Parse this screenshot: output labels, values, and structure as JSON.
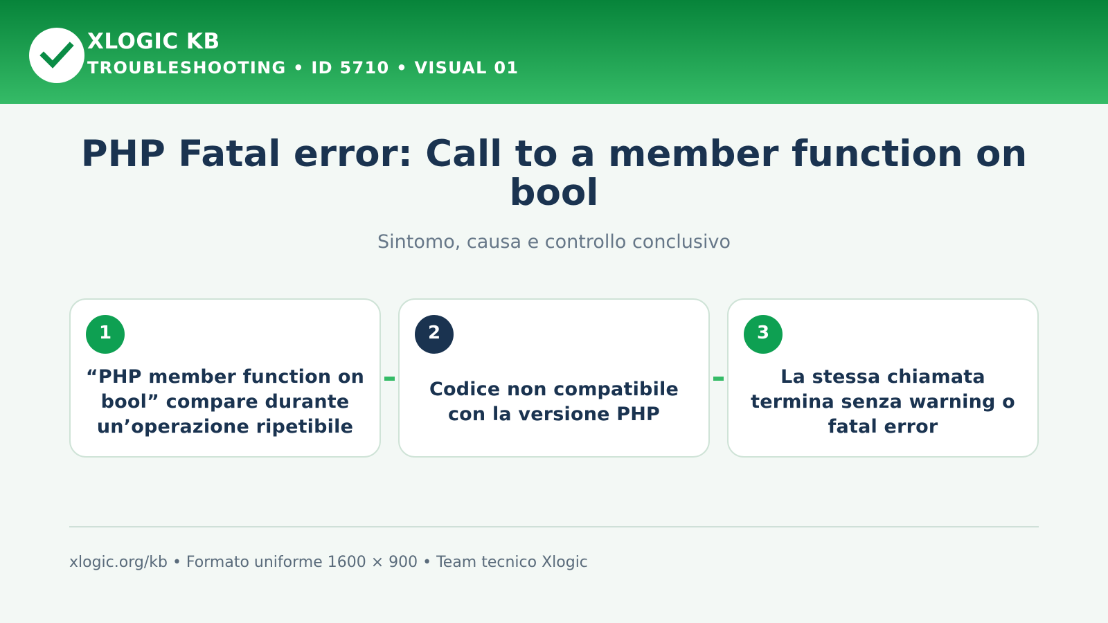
{
  "colors": {
    "header_gradient_top": "#07843a",
    "header_gradient_bottom": "#35bb67",
    "navy": "#1a3350",
    "green": "#0ea052",
    "page_background": "#f3f8f5"
  },
  "header": {
    "logo_icon": "checkmark-icon",
    "brand_title": "XLOGIC KB",
    "brand_subtitle": "TROUBLESHOOTING • ID 5710 • VISUAL 01"
  },
  "main": {
    "title": "PHP Fatal error: Call to a member function on bool",
    "subtitle": "Sintomo, causa e controllo conclusivo"
  },
  "steps": [
    {
      "number": "1",
      "badge_color": "#0ea052",
      "text": "“PHP member function on bool” compare durante un’operazione ripetibile"
    },
    {
      "number": "2",
      "badge_color": "#1a3350",
      "text": "Codice non compatibile con la versione PHP"
    },
    {
      "number": "3",
      "badge_color": "#0ea052",
      "text": "La stessa chiamata termina senza warning o fatal error"
    }
  ],
  "footer": {
    "text": "xlogic.org/kb • Formato uniforme 1600 × 900 • Team tecnico Xlogic"
  }
}
